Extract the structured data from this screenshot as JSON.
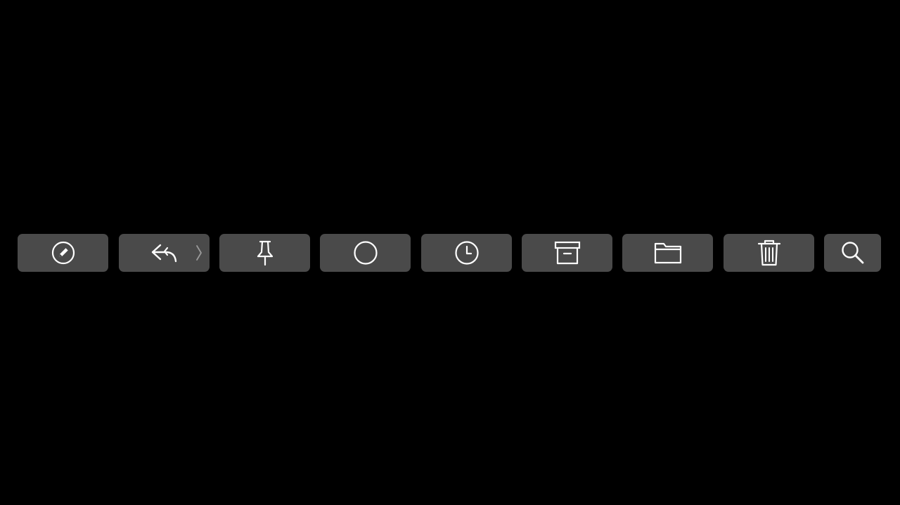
{
  "touchbar": {
    "background_color": "#000000",
    "button_color": "#4a4a4a",
    "icon_color": "#ffffff",
    "buttons": [
      {
        "icon": "compose-icon"
      },
      {
        "icon": "reply-icon",
        "secondary_icon": "chevron-right-icon"
      },
      {
        "icon": "pin-icon"
      },
      {
        "icon": "circle-icon"
      },
      {
        "icon": "clock-icon"
      },
      {
        "icon": "archive-icon"
      },
      {
        "icon": "folder-icon"
      },
      {
        "icon": "trash-icon"
      },
      {
        "icon": "search-icon"
      }
    ]
  }
}
